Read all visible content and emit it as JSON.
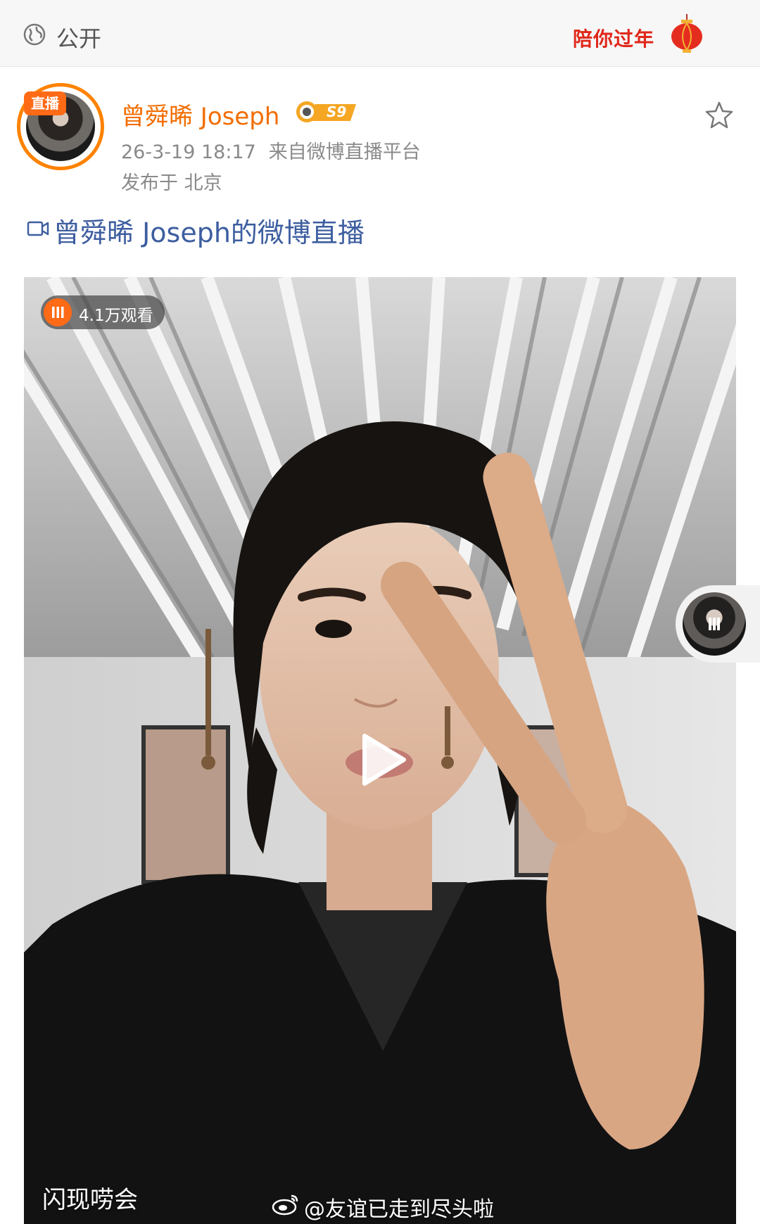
{
  "topbar": {
    "privacy_label": "公开",
    "festival_badge_text": "陪你过年",
    "globe_icon": "globe-icon",
    "lantern_icon": "lantern-icon"
  },
  "post": {
    "avatar_live_tag": "直播",
    "username": "曾舜晞 Joseph",
    "level_badge": "S9",
    "timestamp": "26-3-19 18:17",
    "source": "来自微博直播平台",
    "location": "发布于 北京",
    "star_icon": "star-outline-icon"
  },
  "live": {
    "title": "曾舜晞 Joseph的微博直播",
    "camera_icon": "video-camera-icon"
  },
  "video": {
    "viewer_count": "4.1万观看",
    "caption": "闪现唠会",
    "watermark": "@友谊已走到尽头啦",
    "play_icon": "play-icon"
  },
  "colors": {
    "accent_orange": "#ff8200",
    "username_orange": "#f26d00",
    "link_blue": "#3d5ea0",
    "festival_red": "#e0271a"
  }
}
